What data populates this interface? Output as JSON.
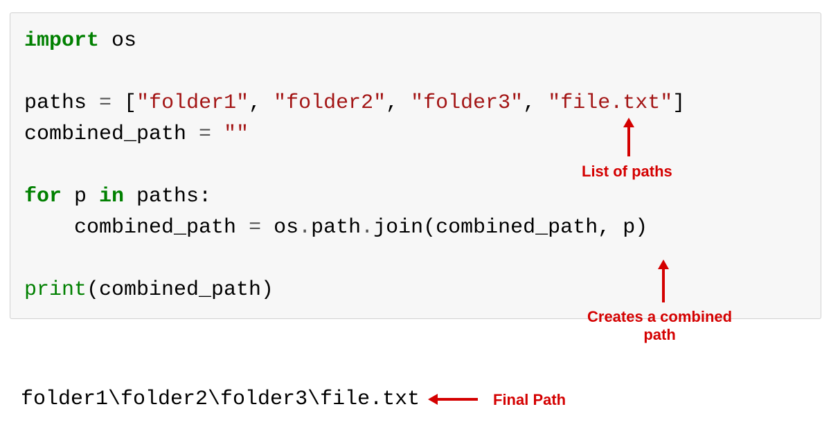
{
  "code": {
    "line1_kw": "import",
    "line1_mod": " os",
    "line3_var": "paths ",
    "line3_eq": "=",
    "line3_sp1": " [",
    "line3_s1": "\"folder1\"",
    "line3_c1": ", ",
    "line3_s2": "\"folder2\"",
    "line3_c2": ", ",
    "line3_s3": "\"folder3\"",
    "line3_c3": ", ",
    "line3_s4": "\"file.txt\"",
    "line3_end": "]",
    "line4_var": "combined_path ",
    "line4_eq": "=",
    "line4_sp": " ",
    "line4_val": "\"\"",
    "line6_for": "for",
    "line6_mid": " p ",
    "line6_in": "in",
    "line6_end": " paths:",
    "line7_indent": "    combined_path ",
    "line7_eq": "=",
    "line7_call": " os",
    "line7_dot1": ".",
    "line7_path": "path",
    "line7_dot2": ".",
    "line7_join": "join(combined_path, p)",
    "line9_print": "print",
    "line9_args": "(combined_path)"
  },
  "output": "folder1\\folder2\\folder3\\file.txt",
  "annotations": {
    "list_of_paths": "List of paths",
    "creates_combined": "Creates a combined\npath",
    "final_path": "Final Path"
  },
  "colors": {
    "keyword": "#008000",
    "string": "#a31515",
    "annotation": "#d40000",
    "code_bg": "#f7f7f7",
    "border": "#d0d0d0"
  }
}
